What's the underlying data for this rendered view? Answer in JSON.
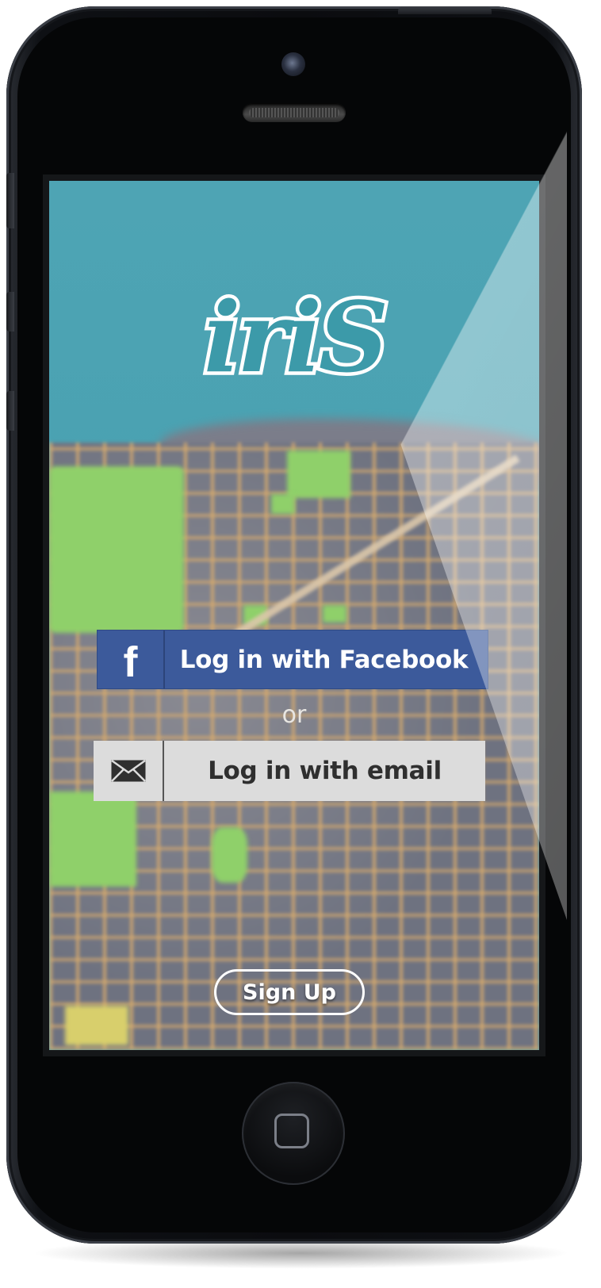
{
  "app": {
    "logo_text": "iriS"
  },
  "login": {
    "facebook_label": "Log in with Facebook",
    "facebook_icon": "f",
    "or_text": "or",
    "email_label": "Log in with email",
    "email_icon": "envelope-icon"
  },
  "signup": {
    "label": "Sign Up"
  },
  "colors": {
    "facebook_blue": "#3c5a9b",
    "email_button_bg": "#dcdcdc",
    "logo_teal": "#3c9aa9",
    "water": "#4ea4b4",
    "park_green": "#8fd06a"
  }
}
